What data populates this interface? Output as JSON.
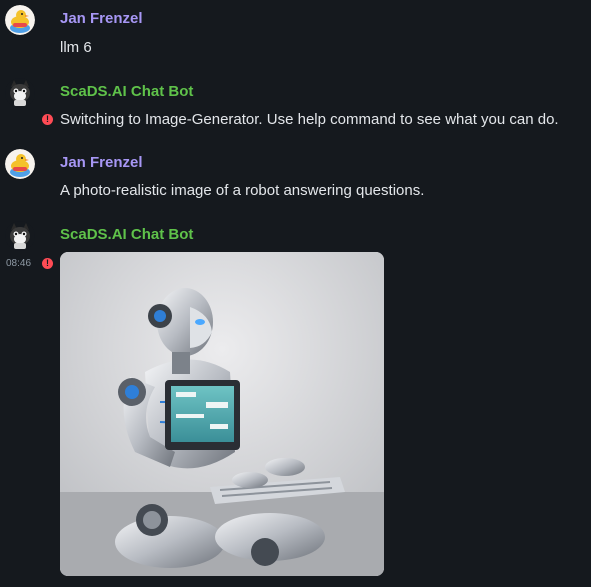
{
  "messages": [
    {
      "sender": "Jan Frenzel",
      "text": "llm 6"
    },
    {
      "sender": "ScaDS.AI Chat Bot",
      "text": "Switching to Image-Generator. Use help command to see what you can do."
    },
    {
      "sender": "Jan Frenzel",
      "text": "A photo-realistic image of a robot answering questions."
    },
    {
      "sender": "ScaDS.AI Chat Bot",
      "timestamp": "08:46",
      "attachment": "robot-image"
    }
  ],
  "colors": {
    "background": "#15191e",
    "user_name": "#a797f5",
    "bot_name": "#5fc24a",
    "warning": "#ff4b55"
  }
}
